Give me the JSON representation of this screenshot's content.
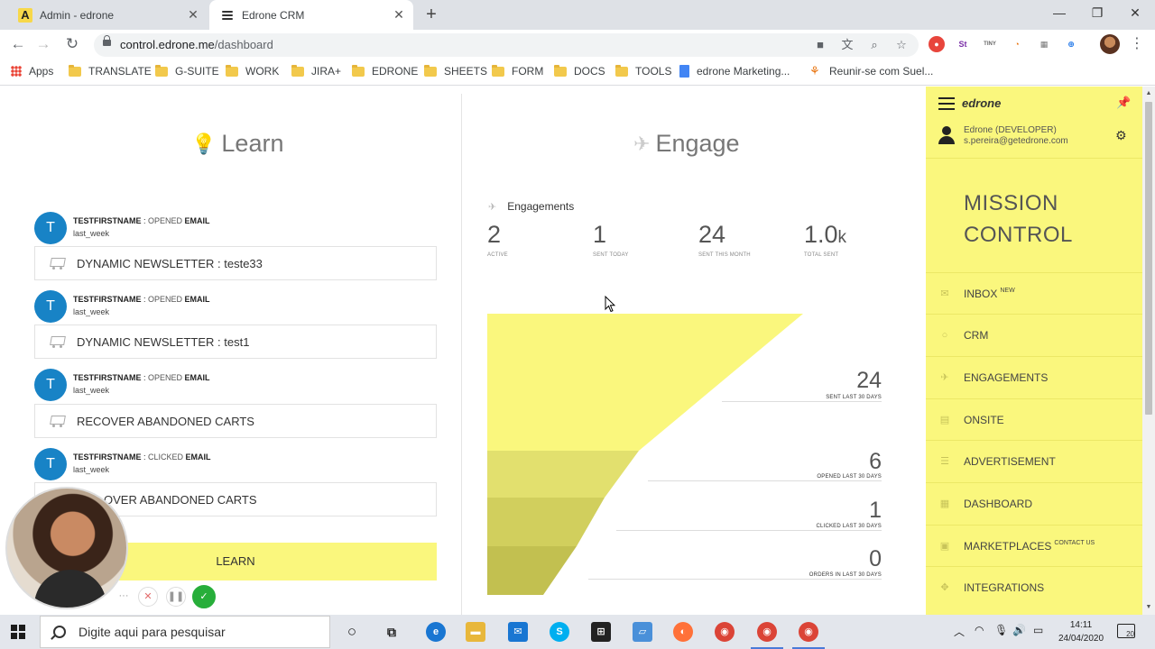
{
  "browser": {
    "tabs": [
      {
        "title": "Admin - edrone",
        "favicon": "A"
      },
      {
        "title": "Edrone CRM",
        "favicon": "edrone-lines-icon"
      }
    ],
    "url_host": "control.edrone.me",
    "url_path": "/dashboard",
    "bookmarks": [
      "Apps",
      "TRANSLATE",
      "G-SUITE",
      "WORK",
      "JIRA+",
      "EDRONE",
      "SHEETS",
      "FORM",
      "DOCS",
      "TOOLS",
      "edrone Marketing...",
      "Reunir-se com Suel..."
    ]
  },
  "learn": {
    "title": "Learn",
    "activities": [
      {
        "initial": "T",
        "name": "TESTFIRSTNAME",
        "sep": " : ",
        "action": "OPENED",
        "object": " EMAIL",
        "when": "last_week",
        "item": "DYNAMIC NEWSLETTER : teste33"
      },
      {
        "initial": "T",
        "name": "TESTFIRSTNAME",
        "sep": " : ",
        "action": "OPENED",
        "object": " EMAIL",
        "when": "last_week",
        "item": "DYNAMIC NEWSLETTER : test1"
      },
      {
        "initial": "T",
        "name": "TESTFIRSTNAME",
        "sep": " : ",
        "action": "OPENED",
        "object": " EMAIL",
        "when": "last_week",
        "item": "RECOVER ABANDONED CARTS"
      },
      {
        "initial": "T",
        "name": "TESTFIRSTNAME",
        "sep": " : ",
        "action": "CLICKED",
        "object": " EMAIL",
        "when": "last_week",
        "item": "OVER ABANDONED CARTS"
      }
    ],
    "button": "LEARN"
  },
  "engage": {
    "title": "Engage",
    "subtitle": "Engagements",
    "stats": [
      {
        "value": "2",
        "unit": "",
        "label": "ACTIVE"
      },
      {
        "value": "1",
        "unit": "",
        "label": "SENT TODAY"
      },
      {
        "value": "24",
        "unit": "",
        "label": "SENT THIS MONTH"
      },
      {
        "value": "1.0",
        "unit": "k",
        "label": "TOTAL SENT"
      }
    ],
    "funnel": [
      {
        "value": "24",
        "label": "SENT LAST 30 DAYS"
      },
      {
        "value": "6",
        "label": "OPENED LAST 30 DAYS"
      },
      {
        "value": "1",
        "label": "CLICKED LAST 30 DAYS"
      },
      {
        "value": "0",
        "label": "ORDERS IN LAST 30 DAYS"
      }
    ]
  },
  "sidebar": {
    "brand": "edrone",
    "user_name": "Edrone (DEVELOPER)",
    "user_email": "s.pereira@getedrone.com",
    "heading_line1": "MISSION",
    "heading_line2": "CONTROL",
    "items": [
      {
        "label": "INBOX",
        "sup": "NEW",
        "icon": "envelope-icon"
      },
      {
        "label": "CRM",
        "sup": "",
        "icon": "user-icon"
      },
      {
        "label": "ENGAGEMENTS",
        "sup": "",
        "icon": "paper-plane-icon"
      },
      {
        "label": "ONSITE",
        "sup": "",
        "icon": "document-icon"
      },
      {
        "label": "ADVERTISEMENT",
        "sup": "",
        "icon": "megaphone-icon"
      },
      {
        "label": "DASHBOARD",
        "sup": "",
        "icon": "grid-icon"
      },
      {
        "label": "MARKETPLACES",
        "sup": "CONTACT US",
        "icon": "store-icon"
      },
      {
        "label": "INTEGRATIONS",
        "sup": "",
        "icon": "puzzle-icon"
      }
    ]
  },
  "taskbar": {
    "search_placeholder": "Digite aqui para pesquisar",
    "time": "14:11",
    "date": "24/04/2020",
    "notifications": "20"
  },
  "colors": {
    "accent": "#faf77d",
    "avatar": "#1883c6",
    "funnel_top": "#faf77d"
  }
}
